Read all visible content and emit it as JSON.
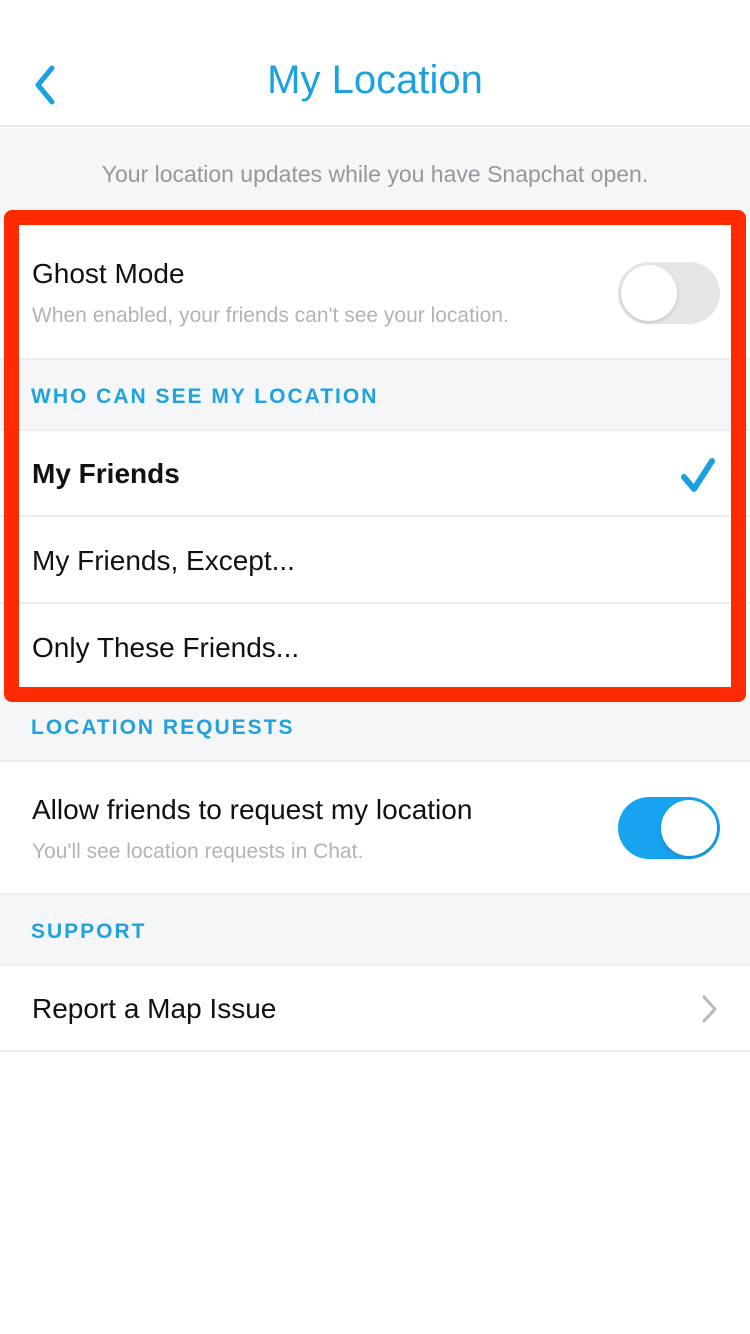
{
  "header": {
    "title": "My Location",
    "back_icon": "chevron-left-icon"
  },
  "intro_text": "Your location updates while you have Snapchat open.",
  "ghost_mode": {
    "title": "Ghost Mode",
    "subtitle": "When enabled, your friends can't see your location.",
    "enabled": false
  },
  "who_can_see": {
    "section_label": "WHO CAN SEE MY LOCATION",
    "options": [
      {
        "label": "My Friends",
        "selected": true
      },
      {
        "label": "My Friends, Except...",
        "selected": false
      },
      {
        "label": "Only These Friends...",
        "selected": false
      }
    ]
  },
  "location_requests": {
    "section_label": "LOCATION REQUESTS",
    "title": "Allow friends to request my location",
    "subtitle": "You'll see location requests in Chat.",
    "enabled": true
  },
  "support": {
    "section_label": "SUPPORT",
    "items": [
      {
        "label": "Report a Map Issue",
        "icon": "chevron-right-icon"
      }
    ]
  },
  "colors": {
    "accent": "#1aa1e0",
    "toggle_on": "#17a3ef",
    "highlight": "#ff2a00"
  }
}
